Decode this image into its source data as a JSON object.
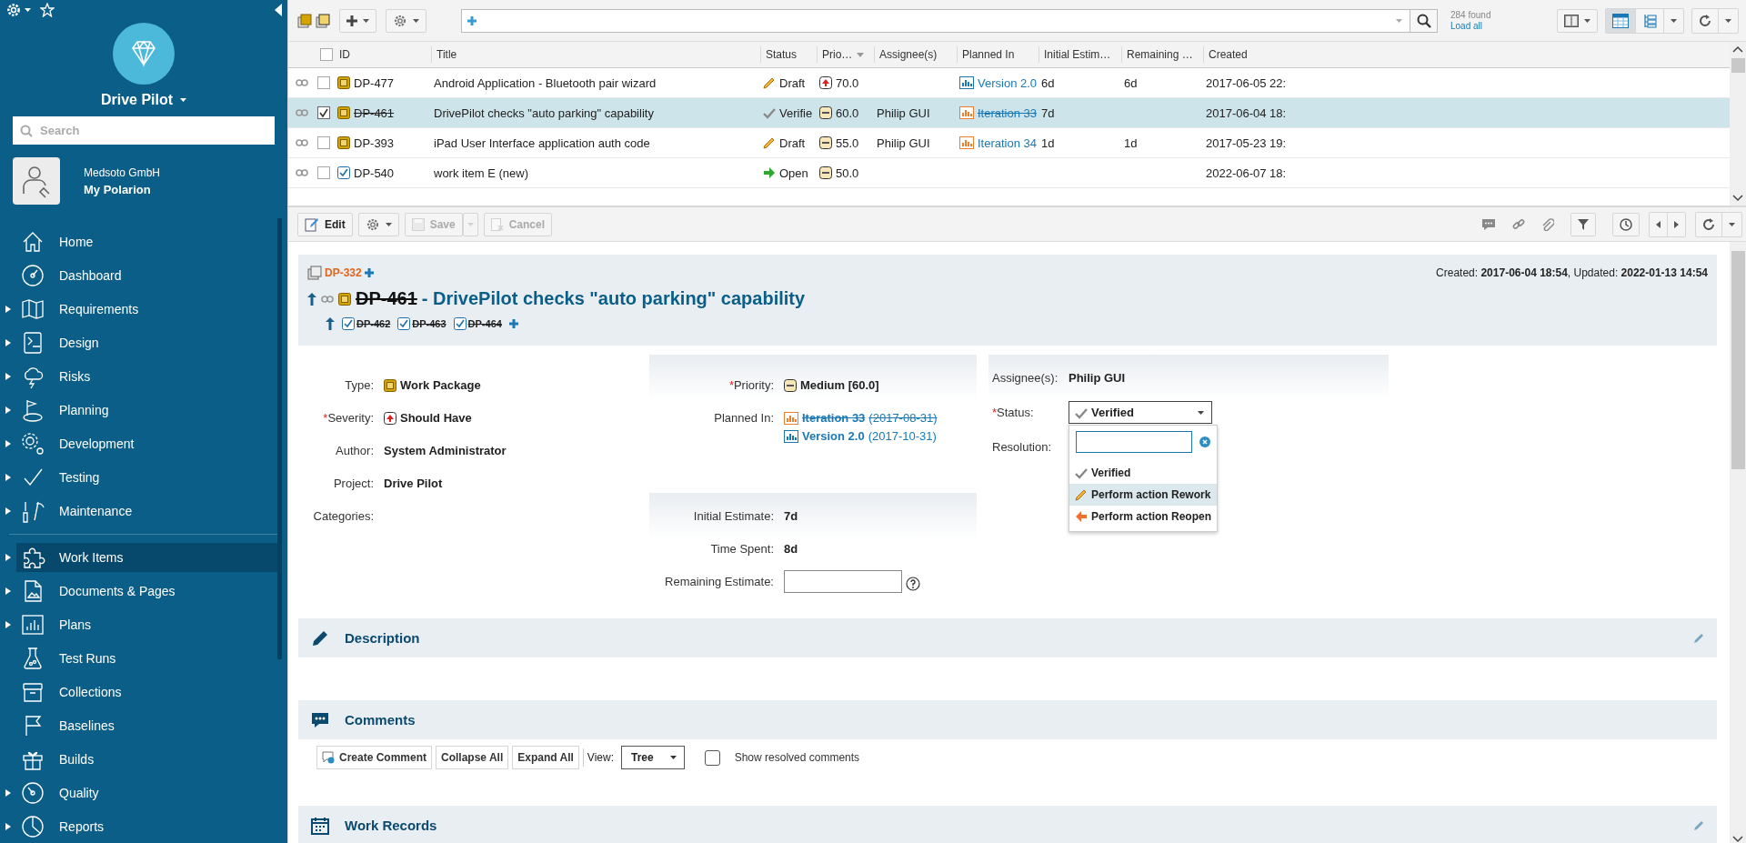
{
  "sidebar": {
    "project": "Drive Pilot",
    "search": {
      "placeholder": "Search"
    },
    "account": {
      "company": "Medsoto GmbH",
      "name": "My Polarion"
    },
    "sections": [
      {
        "items": [
          {
            "label": "Home",
            "expandable": false,
            "selected": false
          },
          {
            "label": "Dashboard",
            "expandable": false,
            "selected": false
          },
          {
            "label": "Requirements",
            "expandable": true,
            "selected": false
          },
          {
            "label": "Design",
            "expandable": true,
            "selected": false
          },
          {
            "label": "Risks",
            "expandable": true,
            "selected": false
          },
          {
            "label": "Planning",
            "expandable": true,
            "selected": false
          },
          {
            "label": "Development",
            "expandable": true,
            "selected": false
          },
          {
            "label": "Testing",
            "expandable": true,
            "selected": false
          },
          {
            "label": "Maintenance",
            "expandable": true,
            "selected": false
          }
        ]
      },
      {
        "items": [
          {
            "label": "Work Items",
            "expandable": true,
            "selected": true
          },
          {
            "label": "Documents & Pages",
            "expandable": true,
            "selected": false
          },
          {
            "label": "Plans",
            "expandable": true,
            "selected": false
          },
          {
            "label": "Test Runs",
            "expandable": false,
            "selected": false
          },
          {
            "label": "Collections",
            "expandable": false,
            "selected": false
          },
          {
            "label": "Baselines",
            "expandable": false,
            "selected": false
          },
          {
            "label": "Builds",
            "expandable": false,
            "selected": false
          },
          {
            "label": "Quality",
            "expandable": true,
            "selected": false
          },
          {
            "label": "Reports",
            "expandable": true,
            "selected": false
          }
        ]
      }
    ]
  },
  "toolbar": {
    "result_count": "284 found",
    "load_all": "Load all",
    "views": [
      {
        "kind": "table",
        "selected": true
      },
      {
        "kind": "tree",
        "selected": false
      }
    ]
  },
  "table": {
    "all_checked": false,
    "columns": [
      {
        "label": "ID",
        "sorted": false
      },
      {
        "label": "Title",
        "sorted": false
      },
      {
        "label": "Status",
        "sorted": false
      },
      {
        "label": "Prio…",
        "sorted": true
      },
      {
        "label": "Assignee(s)",
        "sorted": false
      },
      {
        "label": "Planned In",
        "sorted": false
      },
      {
        "label": "Initial Estim…",
        "sorted": false
      },
      {
        "label": "Remaining …",
        "sorted": false
      },
      {
        "label": "Created",
        "sorted": false
      }
    ],
    "rows": [
      {
        "kind": "work_package",
        "id": "DP-477",
        "resolved": false,
        "title": "Android Application - Bluetooth pair wizard",
        "status": {
          "label": "Draft",
          "kind": "draft"
        },
        "priority": {
          "value": "70.0",
          "kind": "high"
        },
        "planned_in": {
          "label": "Version 2.0",
          "kind": "version",
          "resolved": false
        },
        "initial_estimate": "6d",
        "remaining_estimate": "6d",
        "created": "2017-06-05 22:",
        "checked": false,
        "selected": false
      },
      {
        "kind": "work_package",
        "id": "DP-461",
        "resolved": true,
        "title": "DrivePilot checks \"auto parking\" capability",
        "status": {
          "label": "Verifie",
          "kind": "verified"
        },
        "priority": {
          "value": "60.0",
          "kind": "medium"
        },
        "assignee": "Philip GUI",
        "planned_in": {
          "label": "Iteration 33",
          "kind": "iteration",
          "resolved": true
        },
        "initial_estimate": "7d",
        "created": "2017-06-04 18:",
        "checked": true,
        "selected": true
      },
      {
        "kind": "work_package",
        "id": "DP-393",
        "resolved": false,
        "title": "iPad User Interface application auth code",
        "status": {
          "label": "Draft",
          "kind": "draft"
        },
        "priority": {
          "value": "55.0",
          "kind": "medium"
        },
        "assignee": "Philip GUI",
        "planned_in": {
          "label": "Iteration 34",
          "kind": "iteration",
          "resolved": false
        },
        "initial_estimate": "1d",
        "remaining_estimate": "1d",
        "created": "2017-05-23 19:",
        "checked": false,
        "selected": false
      },
      {
        "kind": "task",
        "id": "DP-540",
        "resolved": false,
        "title": "work item E (new)",
        "status": {
          "label": "Open",
          "kind": "open"
        },
        "priority": {
          "value": "50.0",
          "kind": "medium"
        },
        "created": "2022-06-07 18:",
        "checked": false,
        "selected": false
      }
    ]
  },
  "detail": {
    "toolbar": {
      "buttons": [
        {
          "kind": "edit",
          "label": "Edit",
          "disabled": false
        },
        {
          "kind": "actions",
          "disabled": false
        },
        {
          "kind": "save",
          "label": "Save",
          "disabled": true
        },
        {
          "kind": "cancel",
          "label": "Cancel",
          "disabled": true
        }
      ]
    },
    "header": {
      "parent": "DP-332",
      "created_info": "Created: **2017-06-04 18:54**, Updated: **2022-01-13 14:54**",
      "kind": "work_package",
      "id": "DP-461",
      "resolved": true,
      "title": "- DrivePilot checks \"auto parking\" capability",
      "children": [
        {
          "id": "DP-462",
          "resolved": true
        },
        {
          "id": "DP-463",
          "resolved": true
        },
        {
          "id": "DP-464",
          "resolved": true
        }
      ]
    },
    "columns": [
      {
        "panels": [
          {
            "shaded": false,
            "fields": [
              {
                "label": "Type:",
                "kind": "type",
                "value": {
                  "text": "Work Package",
                  "kind": "work_package"
                }
              },
              {
                "label": "Severity:",
                "required_mark": "*",
                "kind": "priority",
                "value": {
                  "text": "Should Have",
                  "kind": "high"
                }
              },
              {
                "label": "Author:",
                "kind": "text",
                "value": "System Administrator"
              },
              {
                "label": "Project:",
                "kind": "text",
                "value": "Drive Pilot"
              },
              {
                "label": "Categories:",
                "kind": "none"
              }
            ]
          }
        ]
      },
      {
        "panels": [
          {
            "shaded": true,
            "fields": [
              {
                "label": "Priority:",
                "required_mark": "*",
                "kind": "priority",
                "value": {
                  "text": "Medium [60.0]",
                  "kind": "medium"
                }
              },
              {
                "label": "Planned In:",
                "kind": "plans",
                "links": [
                  {
                    "label": "Iteration 33",
                    "date": "(2017-08-31)",
                    "kind": "iteration",
                    "resolved": true
                  },
                  {
                    "label": "Version 2.0",
                    "date": "(2017-10-31)",
                    "kind": "version",
                    "resolved": false
                  }
                ]
              }
            ]
          },
          {
            "shaded": true,
            "fields": [
              {
                "label": "Initial Estimate:",
                "kind": "text",
                "value": "7d"
              },
              {
                "label": "Time Spent:",
                "kind": "text",
                "value": "8d"
              },
              {
                "label": "Remaining Estimate:",
                "kind": "input"
              }
            ]
          }
        ]
      },
      {
        "panels": [
          {
            "shaded": true,
            "fields": [
              {
                "label": "Assignee(s):",
                "kind": "text",
                "value": "Philip GUI"
              },
              {
                "label": "Status:",
                "required_mark": "*",
                "kind": "status",
                "value": {
                  "text": "Verified",
                  "kind": "verified"
                },
                "expanded": true,
                "options": [
                  {
                    "label": "Verified",
                    "kind": "verified",
                    "selected": false
                  },
                  {
                    "label": "Perform action Rework",
                    "kind": "draft",
                    "selected": true
                  },
                  {
                    "label": "Perform action Reopen",
                    "kind": "reopen",
                    "selected": false
                  }
                ]
              },
              {
                "label": "Resolution:",
                "kind": "none"
              }
            ]
          }
        ]
      }
    ],
    "sections": [
      {
        "kind": "description",
        "title": "Description",
        "editable": true
      },
      {
        "kind": "comments",
        "title": "Comments",
        "editable": false,
        "toolbar": {
          "buttons": [
            {
              "label": "Create Comment",
              "kind": "create"
            },
            {
              "label": "Collapse All",
              "kind": "plain"
            },
            {
              "label": "Expand All",
              "kind": "plain"
            }
          ],
          "view_label": "View:",
          "view": "Tree",
          "show_resolved": {
            "label": "Show resolved comments",
            "checked": false
          }
        }
      },
      {
        "kind": "work_records",
        "title": "Work Records",
        "editable": true
      }
    ]
  }
}
